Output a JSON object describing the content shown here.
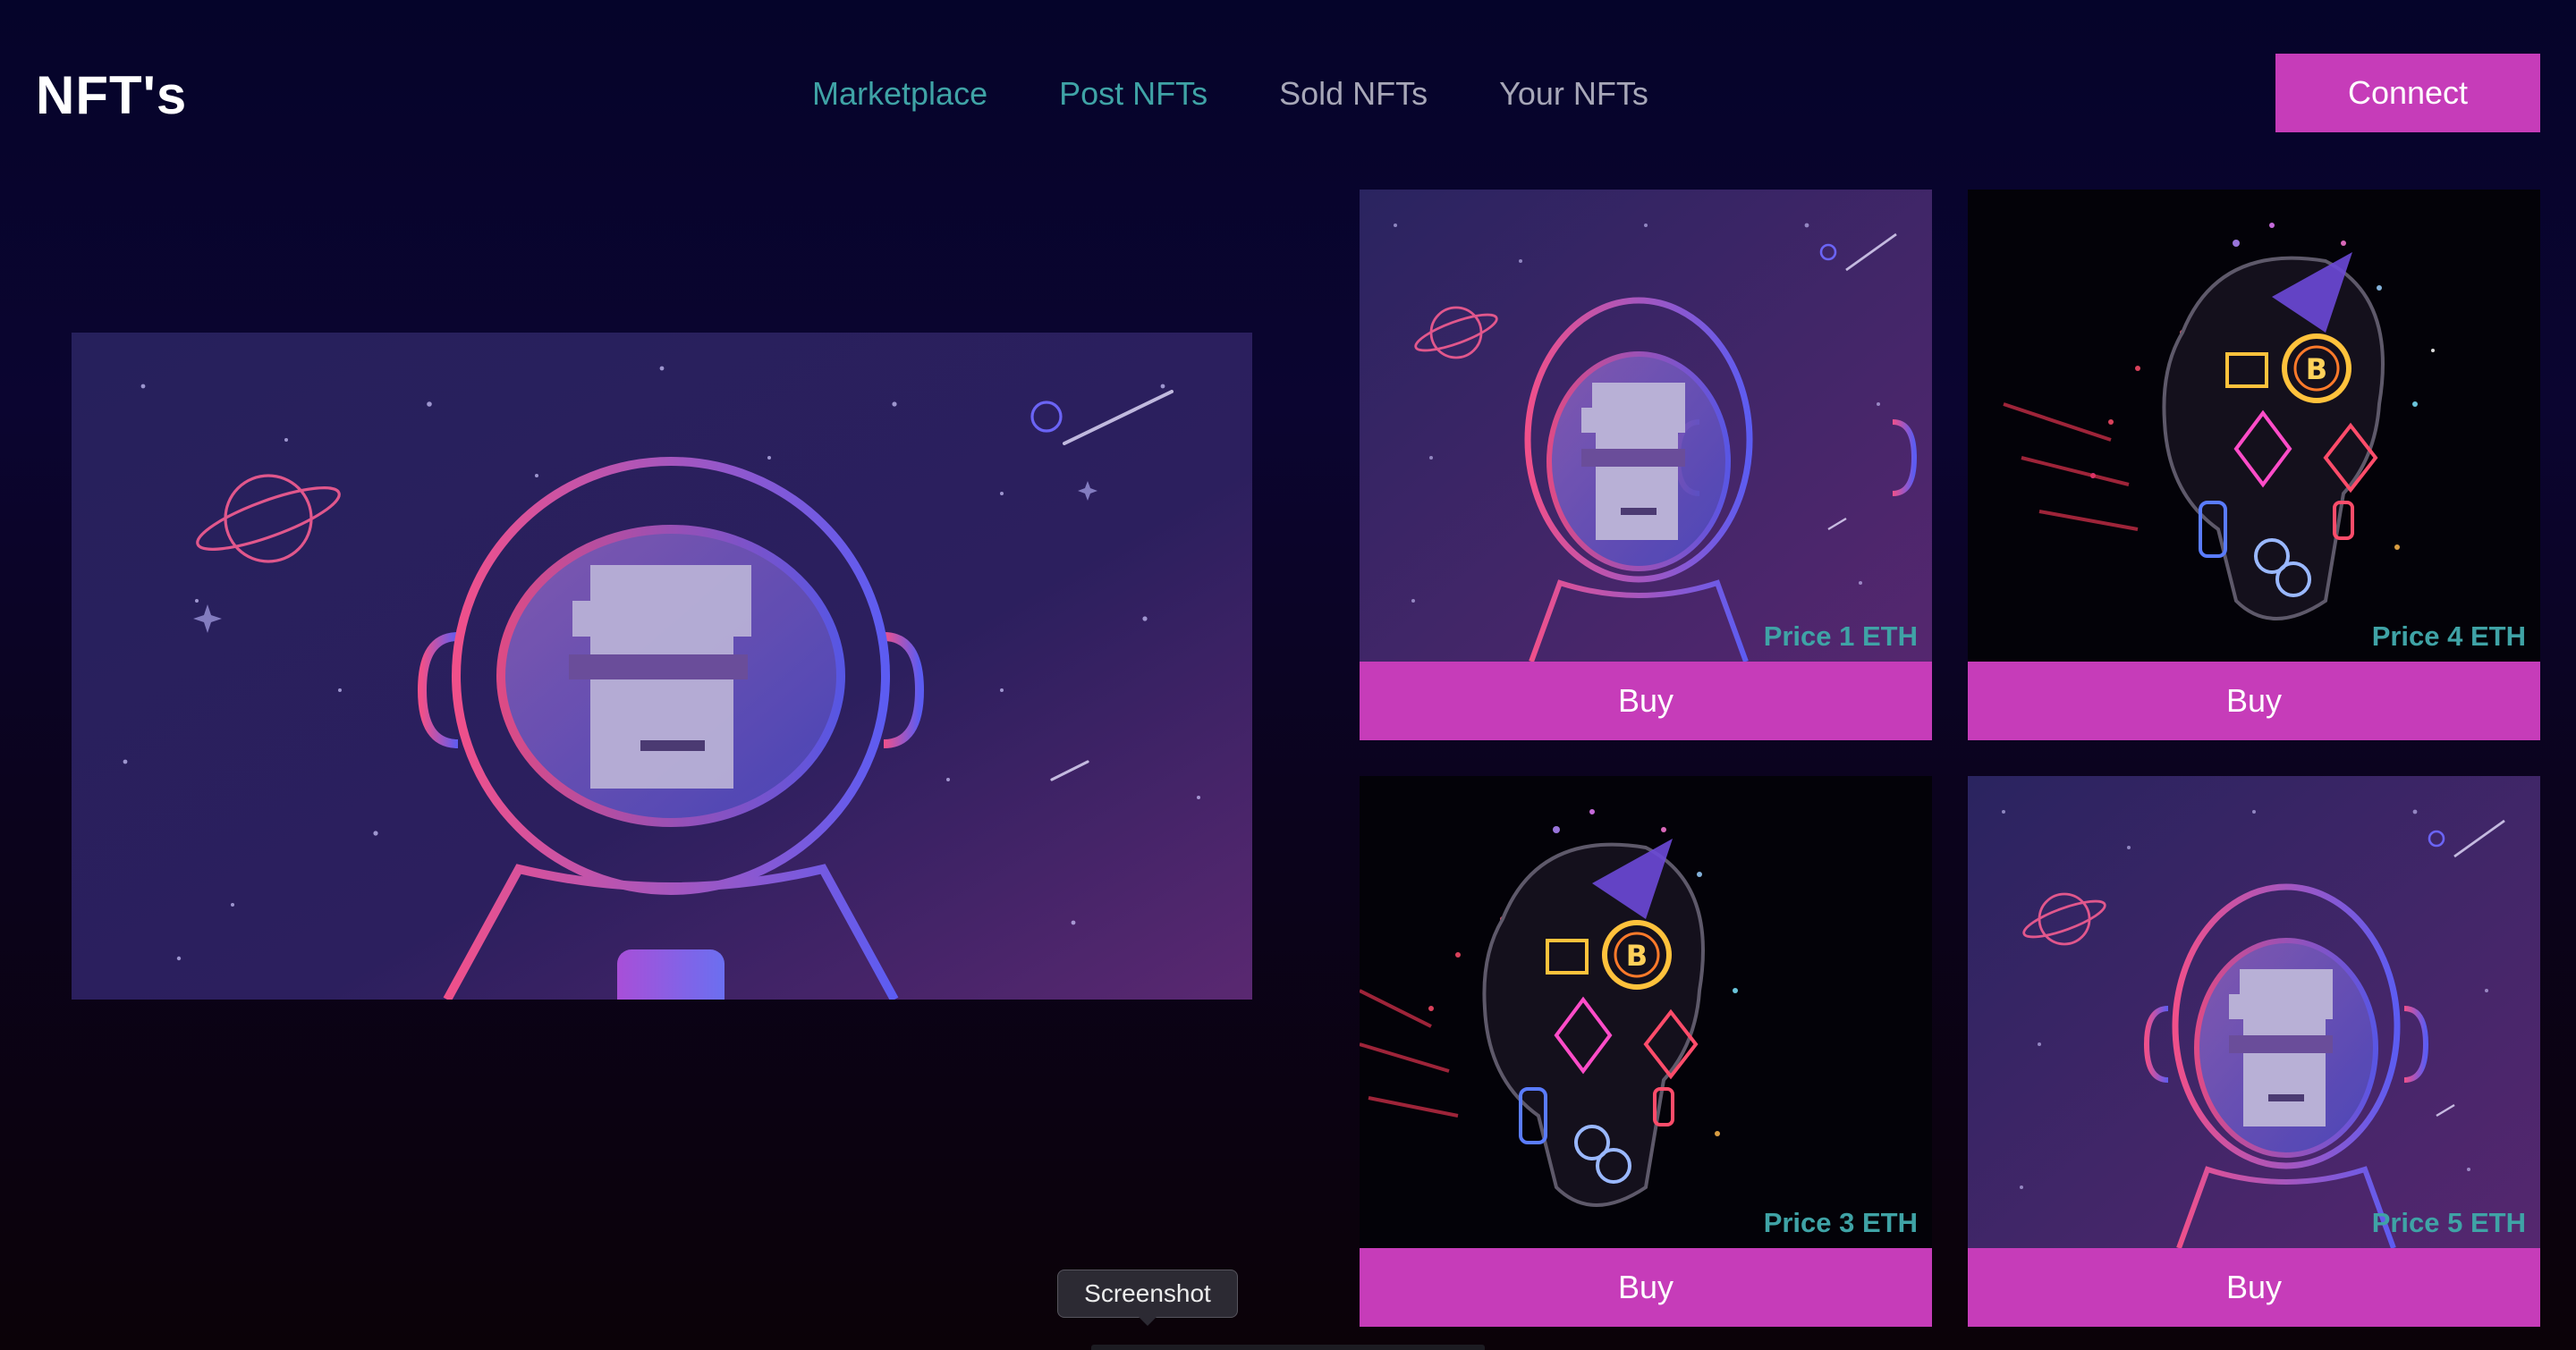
{
  "header": {
    "brand": "NFT's",
    "nav": [
      {
        "label": "Marketplace",
        "state": "active"
      },
      {
        "label": "Post NFTs",
        "state": "active"
      },
      {
        "label": "Sold NFTs",
        "state": "inactive"
      },
      {
        "label": "Your NFTs",
        "state": "inactive"
      }
    ],
    "connect_label": "Connect"
  },
  "hero": {
    "image_icon": "astronaut-illustration"
  },
  "cards": [
    {
      "art": "astronaut-illustration",
      "price": "Price 1 ETH",
      "buy_label": "Buy"
    },
    {
      "art": "neon-crypto-head",
      "price": "Price 4 ETH",
      "buy_label": "Buy"
    },
    {
      "art": "neon-crypto-head",
      "price": "Price 3 ETH",
      "buy_label": "Buy"
    },
    {
      "art": "astronaut-illustration",
      "price": "Price 5 ETH",
      "buy_label": "Buy"
    }
  ],
  "tooltip": {
    "text": "Screenshot"
  },
  "colors": {
    "accent": "#c63cb9",
    "teal": "#3fa3a6",
    "nav_inactive": "#a7a7b8",
    "background": "#05042a"
  }
}
